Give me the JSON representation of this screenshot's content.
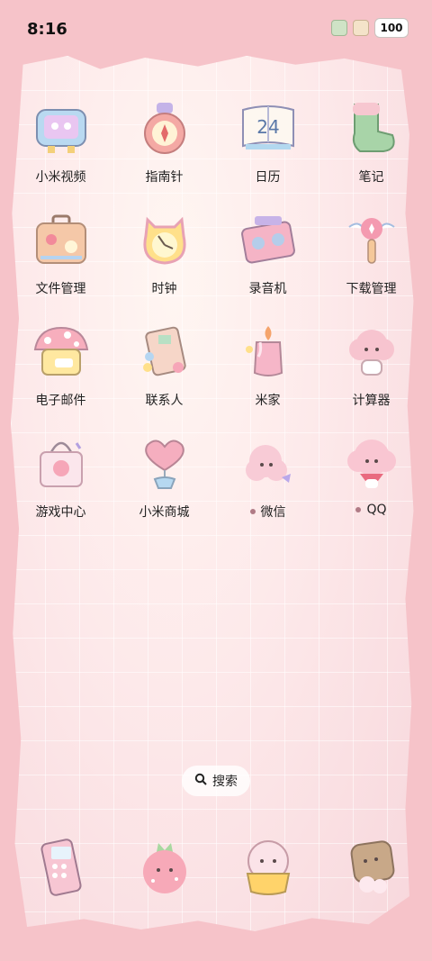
{
  "status": {
    "time": "8:16",
    "battery": "100"
  },
  "apps": [
    {
      "label": "小米视频",
      "icon": "tv-icon"
    },
    {
      "label": "指南针",
      "icon": "compass-icon"
    },
    {
      "label": "日历",
      "icon": "calendar-icon",
      "day": "24"
    },
    {
      "label": "笔记",
      "icon": "sock-icon"
    },
    {
      "label": "文件管理",
      "icon": "suitcase-icon"
    },
    {
      "label": "时钟",
      "icon": "clock-icon"
    },
    {
      "label": "录音机",
      "icon": "cassette-icon"
    },
    {
      "label": "下载管理",
      "icon": "wand-icon"
    },
    {
      "label": "电子邮件",
      "icon": "mushroom-house-icon"
    },
    {
      "label": "联系人",
      "icon": "contacts-book-icon"
    },
    {
      "label": "米家",
      "icon": "candle-icon"
    },
    {
      "label": "计算器",
      "icon": "cloud-creature-icon"
    },
    {
      "label": "游戏中心",
      "icon": "tote-bag-icon"
    },
    {
      "label": "小米商城",
      "icon": "heart-balloon-icon"
    },
    {
      "label": "微信",
      "icon": "cotton-cloud-icon",
      "new": true
    },
    {
      "label": "QQ",
      "icon": "fluffy-bun-icon",
      "new": true
    }
  ],
  "search": {
    "label": "搜索"
  },
  "dock": [
    {
      "icon": "phone-icon"
    },
    {
      "icon": "strawberry-icon"
    },
    {
      "icon": "donut-cup-icon"
    },
    {
      "icon": "toast-icon"
    }
  ]
}
